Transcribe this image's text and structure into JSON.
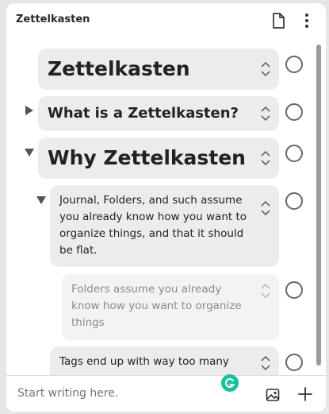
{
  "app": {
    "title": "Zettelkasten"
  },
  "blocks": [
    {
      "text": "Zettelkasten"
    },
    {
      "text": "What is a Zettelkasten?"
    },
    {
      "text": "Why Zettelkasten"
    },
    {
      "text": "Journal, Folders, and such assume you already know how you want to organize things, and that it should be flat."
    },
    {
      "text": "Folders assume you already know how you want to organize things"
    },
    {
      "text": "Tags end up with way too many"
    }
  ],
  "composer": {
    "placeholder": "Start writing here."
  },
  "icons": {
    "header": [
      "document-icon",
      "more-vertical-icon"
    ],
    "block": [
      "sort-icon",
      "circle-icon"
    ],
    "toggles": [
      "triangle-right-icon",
      "triangle-down-icon"
    ],
    "bottom": [
      "grammarly-icon",
      "image-icon",
      "plus-icon"
    ]
  },
  "colors": {
    "block_bg": "#ececec",
    "grammarly": "#15c39a",
    "faded_text": "#8a8a8a"
  }
}
